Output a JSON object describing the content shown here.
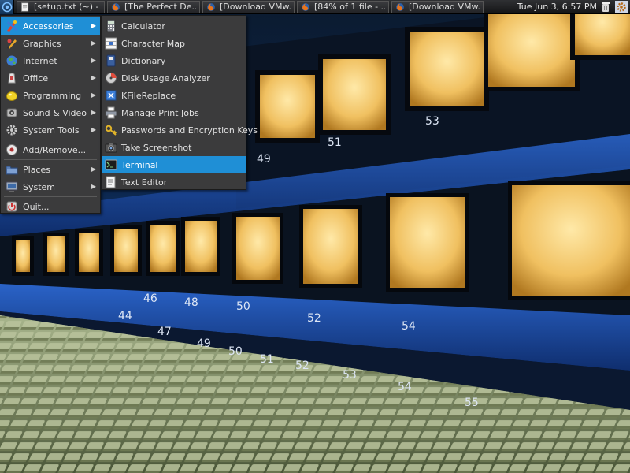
{
  "panel": {
    "menu_button_icon": "debian-swirl-icon",
    "tasks": [
      {
        "label": "[setup.txt (~) - ...",
        "icon": "text-editor-icon"
      },
      {
        "label": "[The Perfect De...",
        "icon": "firefox-icon"
      },
      {
        "label": "[Download VMw...",
        "icon": "firefox-icon"
      },
      {
        "label": "[84% of 1 file - ...",
        "icon": "firefox-icon"
      },
      {
        "label": "[Download VMw...",
        "icon": "firefox-icon"
      }
    ],
    "clock": "Tue Jun  3,  6:57 PM",
    "tray_icons": [
      "trash-icon",
      "gear-icon"
    ]
  },
  "main_menu": {
    "items": [
      {
        "label": "Accessories",
        "icon": "accessories-icon",
        "submenu": true,
        "active": true
      },
      {
        "label": "Graphics",
        "icon": "graphics-icon",
        "submenu": true
      },
      {
        "label": "Internet",
        "icon": "internet-icon",
        "submenu": true
      },
      {
        "label": "Office",
        "icon": "office-icon",
        "submenu": true
      },
      {
        "label": "Programming",
        "icon": "programming-icon",
        "submenu": true
      },
      {
        "label": "Sound & Video",
        "icon": "sound-video-icon",
        "submenu": true
      },
      {
        "label": "System Tools",
        "icon": "system-tools-icon",
        "submenu": true
      },
      {
        "label": "Add/Remove...",
        "icon": "add-remove-icon",
        "submenu": false
      },
      {
        "label": "Places",
        "icon": "places-icon",
        "submenu": true
      },
      {
        "label": "System",
        "icon": "system-icon",
        "submenu": true
      },
      {
        "label": "Quit...",
        "icon": "quit-icon",
        "submenu": false
      }
    ]
  },
  "accessories_menu": {
    "items": [
      {
        "label": "Calculator",
        "icon": "calculator-icon"
      },
      {
        "label": "Character Map",
        "icon": "character-map-icon"
      },
      {
        "label": "Dictionary",
        "icon": "dictionary-icon"
      },
      {
        "label": "Disk Usage Analyzer",
        "icon": "disk-usage-icon"
      },
      {
        "label": "KFileReplace",
        "icon": "kfilereplace-icon"
      },
      {
        "label": "Manage Print Jobs",
        "icon": "printer-icon"
      },
      {
        "label": "Passwords and Encryption Keys",
        "icon": "keys-icon"
      },
      {
        "label": "Take Screenshot",
        "icon": "camera-icon"
      },
      {
        "label": "Terminal",
        "icon": "terminal-icon",
        "active": true
      },
      {
        "label": "Text Editor",
        "icon": "text-editor-icon"
      }
    ]
  },
  "wallpaper": {
    "meter_numbers": [
      "53",
      "51",
      "49",
      "46",
      "48",
      "50",
      "52",
      "54",
      "44",
      "47",
      "49",
      "50",
      "51",
      "52",
      "53",
      "54",
      "55"
    ]
  },
  "colors": {
    "highlight": "#1f8fd6",
    "menu_bg": "#3b3b3c",
    "panel_bg": "#1e1f21"
  }
}
